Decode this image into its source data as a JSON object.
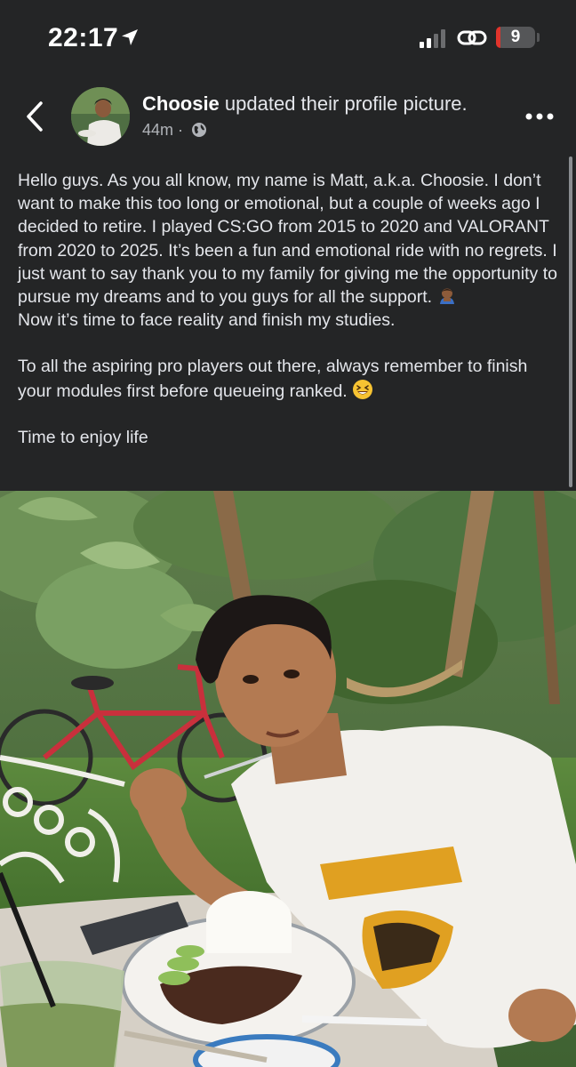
{
  "status_bar": {
    "time": "22:17",
    "battery_level": "9",
    "battery_percent": 9,
    "colors": {
      "battery_low": "#e0342c"
    }
  },
  "post": {
    "author": "Choosie",
    "action": " updated their profile picture.",
    "age": "44m",
    "separator": "·",
    "privacy_icon": "globe-icon",
    "paragraphs": [
      "Hello guys. As you all know, my name is Matt, a.k.a. Choosie. I don’t want to make this too long or emotional, but a couple of weeks ago I decided to retire. I played CS:GO from 2015 to 2020 and VALORANT from 2020 to 2025. It’s been a fun and emotional ride with no regrets. I just want to say thank you to my family for giving me the opportunity to pursue my dreams and to you guys for all the support.",
      "Now it’s time to face reality and finish my studies.",
      "To all the aspiring pro players out there, always remember to finish your modules first before queueing ranked.",
      "Time to enjoy life"
    ],
    "icons": [
      "back-icon",
      "more-icon",
      "bowing-person-emoji",
      "laughing-face-emoji"
    ]
  },
  "colors": {
    "background": "#242526",
    "text": "#e4e6eb",
    "secondary_text": "#b0b3b8"
  }
}
